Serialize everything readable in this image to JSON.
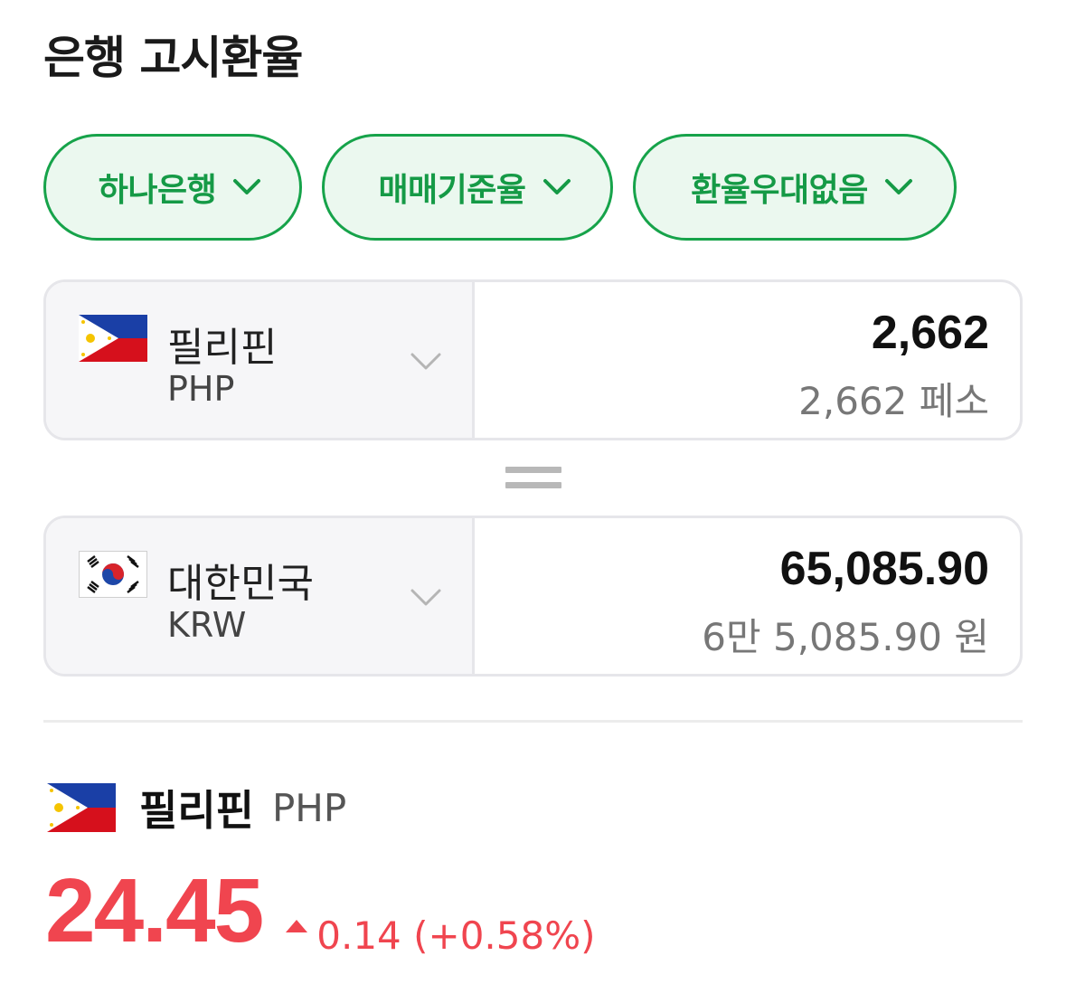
{
  "header": {
    "title": "은행 고시환율"
  },
  "filters": [
    {
      "label": "하나은행"
    },
    {
      "label": "매매기준율"
    },
    {
      "label": "환율우대없음"
    }
  ],
  "from": {
    "country": "필리핀",
    "code": "PHP",
    "amount": "2,662",
    "amount_text": "2,662 페소",
    "flag_icon": "philippines-flag-icon"
  },
  "to": {
    "country": "대한민국",
    "code": "KRW",
    "amount": "65,085.90",
    "amount_text": "6만 5,085.90 원",
    "flag_icon": "south-korea-flag-icon"
  },
  "rate": {
    "country": "필리핀",
    "code": "PHP",
    "value": "24.45",
    "change": "0.14 (+0.58%)",
    "direction": "up"
  },
  "colors": {
    "accent_green": "#16a34a",
    "up_red": "#f0454f"
  }
}
